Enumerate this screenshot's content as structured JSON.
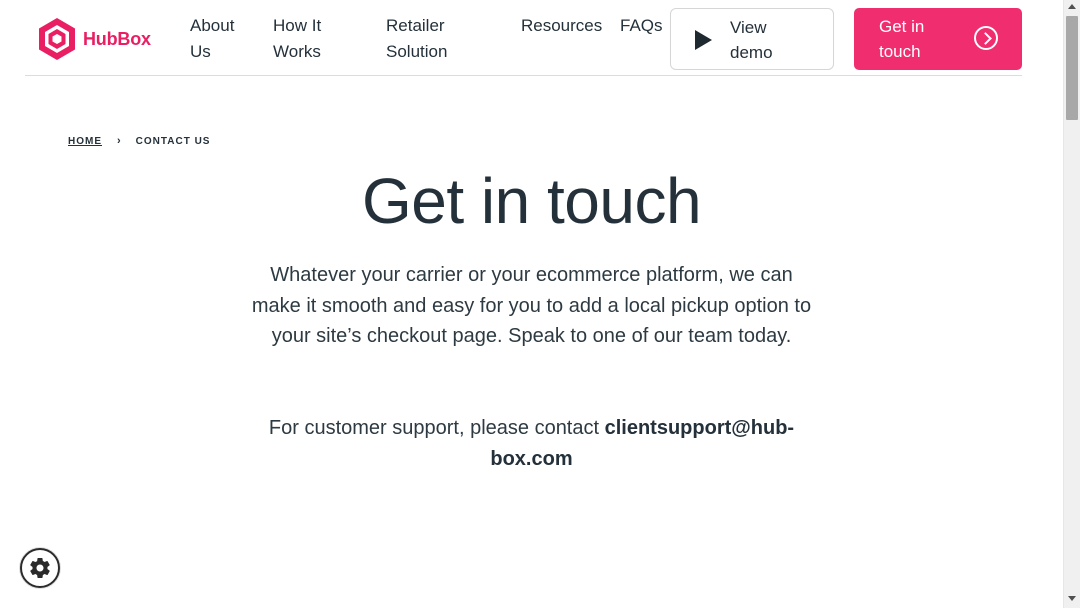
{
  "header": {
    "logo_text": "HubBox",
    "nav": {
      "about": "About Us",
      "how": "How It Works",
      "retailer": "Retailer Solution",
      "resources": "Resources",
      "faqs": "FAQs"
    },
    "demo_label": "View demo",
    "touch_label": "Get in touch"
  },
  "breadcrumb": {
    "home": "HOME",
    "separator": "›",
    "current": "CONTACT US"
  },
  "hero": {
    "title": "Get in touch",
    "lead": "Whatever your carrier or your ecommerce platform, we can make it smooth and easy for you to add a local pickup option to your site’s checkout page. Speak to one of our team today.",
    "support_prefix": "For customer support, please contact ",
    "support_email": "clientsupport@hub-box.com"
  },
  "icons": {
    "logo": "hexagon-logo-icon",
    "demo": "play-icon",
    "touch": "chevron-right-circle-icon",
    "cookie": "gear-icon"
  },
  "colors": {
    "brand": "#e91e63",
    "cta": "#f02d6e",
    "text": "#24313a"
  }
}
